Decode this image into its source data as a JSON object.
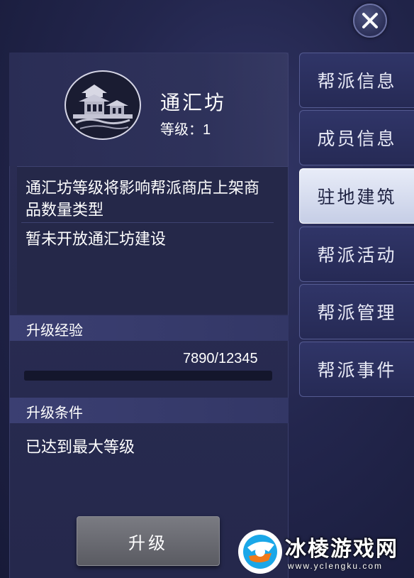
{
  "building": {
    "name": "通汇坊",
    "level_label": "等级：",
    "level_value": "1"
  },
  "description": {
    "line1": "通汇坊等级将影响帮派商店上架商品数量类型",
    "line2": "暂未开放通汇坊建设"
  },
  "upgrade_exp": {
    "title": "升级经验",
    "text": "7890/12345",
    "current": 7890,
    "max": 12345
  },
  "upgrade_condition": {
    "title": "升级条件",
    "text": "已达到最大等级"
  },
  "upgrade_button": {
    "label": "升级"
  },
  "tabs": [
    {
      "label": "帮派信息",
      "active": false
    },
    {
      "label": "成员信息",
      "active": false
    },
    {
      "label": "驻地建筑",
      "active": true
    },
    {
      "label": "帮派活动",
      "active": false
    },
    {
      "label": "帮派管理",
      "active": false
    },
    {
      "label": "帮派事件",
      "active": false
    }
  ],
  "watermark": {
    "title": "冰棱游戏网",
    "url": "www.yclengku.com"
  },
  "colors": {
    "background": "#23264d",
    "tab_active": "#e8ecf8",
    "section_bar": "#3b3f72",
    "button": "#6a6b72"
  },
  "icons": {
    "close": "close-icon",
    "building": "pavilion-icon",
    "watermark_logo": "yclengku-logo-icon"
  }
}
